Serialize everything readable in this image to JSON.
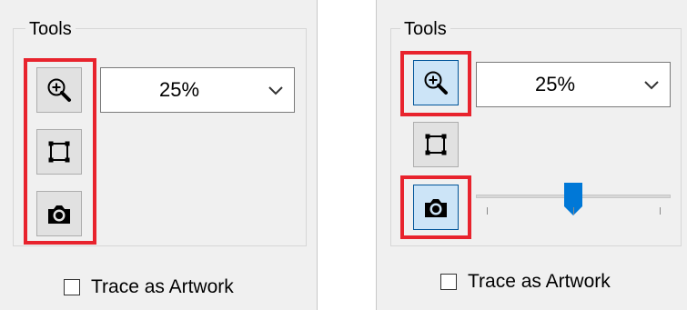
{
  "panels": [
    {
      "group_title": "Tools",
      "zoom": {
        "value": "25%",
        "icon": "chevron-down-icon"
      },
      "tools": [
        {
          "name": "zoom-tool-button",
          "icon": "zoom-in-icon",
          "active": false
        },
        {
          "name": "crop-tool-button",
          "icon": "crop-square-icon",
          "active": false
        },
        {
          "name": "capture-tool-button",
          "icon": "camera-icon",
          "active": false
        }
      ],
      "checkbox": {
        "label": "Trace as Artwork",
        "checked": false
      }
    },
    {
      "group_title": "Tools",
      "zoom": {
        "value": "25%",
        "icon": "chevron-down-icon"
      },
      "tools": [
        {
          "name": "zoom-tool-button",
          "icon": "zoom-in-icon",
          "active": true
        },
        {
          "name": "crop-tool-button",
          "icon": "crop-square-icon",
          "active": false
        },
        {
          "name": "capture-tool-button",
          "icon": "camera-icon",
          "active": true
        }
      ],
      "slider": {
        "value_fraction": 0.5,
        "ticks": 3
      },
      "checkbox": {
        "label": "Trace as Artwork",
        "checked": false
      }
    }
  ],
  "colors": {
    "highlight": "#e8232d",
    "active_button": "#cce4f7",
    "slider_thumb": "#0078d7",
    "panel_bg": "#f0f0f0"
  }
}
